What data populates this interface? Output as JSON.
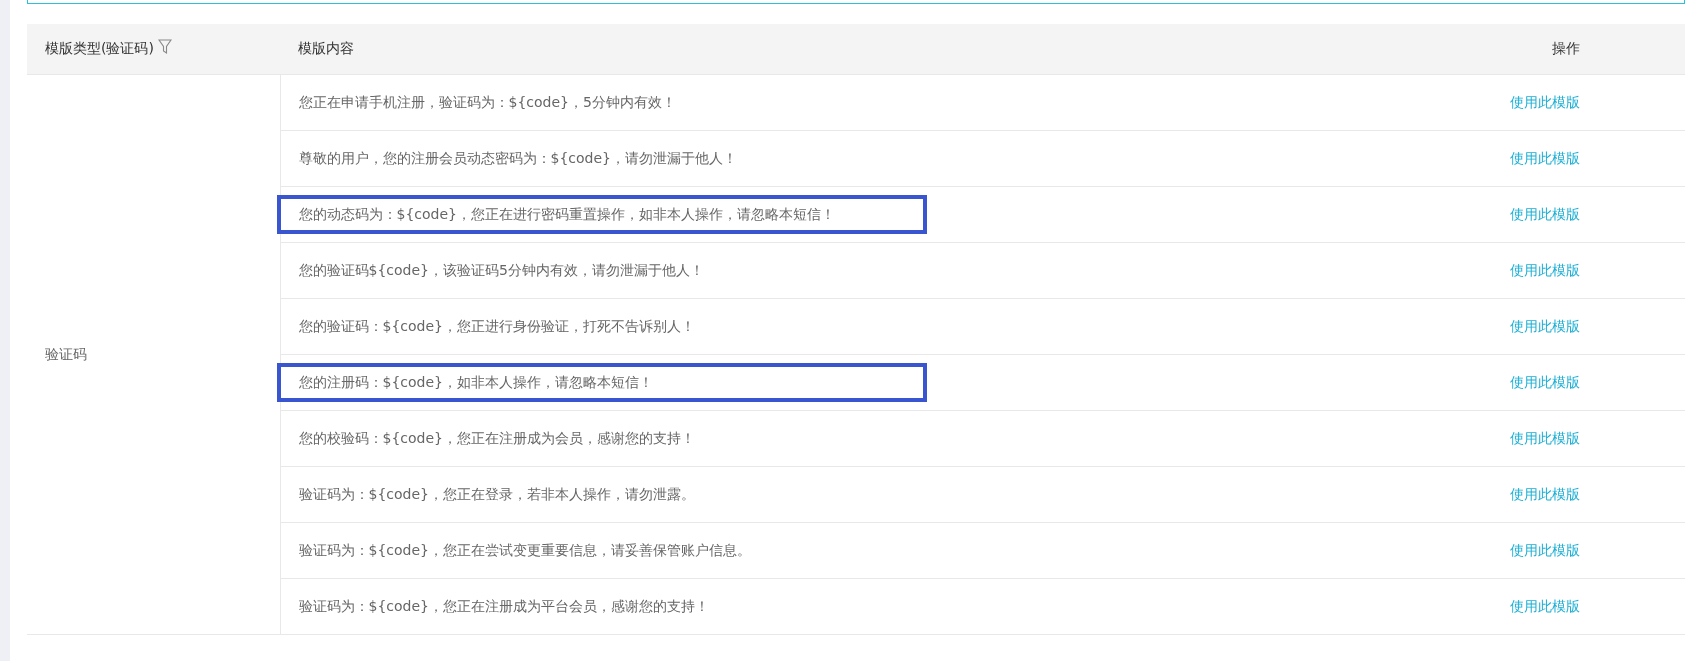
{
  "table": {
    "columns": [
      {
        "label": "模版类型(验证码)",
        "filter": true
      },
      {
        "label": "模版内容",
        "filter": false
      },
      {
        "label": "操作",
        "filter": false
      }
    ],
    "type_cell": "验证码",
    "rows": [
      {
        "content": "您正在申请手机注册，验证码为：${code}，5分钟内有效！",
        "action": "使用此模版",
        "highlighted": false
      },
      {
        "content": "尊敬的用户，您的注册会员动态密码为：${code}，请勿泄漏于他人！",
        "action": "使用此模版",
        "highlighted": false
      },
      {
        "content": "您的动态码为：${code}，您正在进行密码重置操作，如非本人操作，请忽略本短信！",
        "action": "使用此模版",
        "highlighted": true
      },
      {
        "content": "您的验证码${code}，该验证码5分钟内有效，请勿泄漏于他人！",
        "action": "使用此模版",
        "highlighted": false
      },
      {
        "content": "您的验证码：${code}，您正进行身份验证，打死不告诉别人！",
        "action": "使用此模版",
        "highlighted": false
      },
      {
        "content": "您的注册码：${code}，如非本人操作，请忽略本短信！",
        "action": "使用此模版",
        "highlighted": true
      },
      {
        "content": "您的校验码：${code}，您正在注册成为会员，感谢您的支持！",
        "action": "使用此模版",
        "highlighted": false
      },
      {
        "content": "验证码为：${code}，您正在登录，若非本人操作，请勿泄露。",
        "action": "使用此模版",
        "highlighted": false
      },
      {
        "content": "验证码为：${code}，您正在尝试变更重要信息，请妥善保管账户信息。",
        "action": "使用此模版",
        "highlighted": false
      },
      {
        "content": "验证码为：${code}，您正在注册成为平台会员，感谢您的支持！",
        "action": "使用此模版",
        "highlighted": false
      }
    ]
  }
}
